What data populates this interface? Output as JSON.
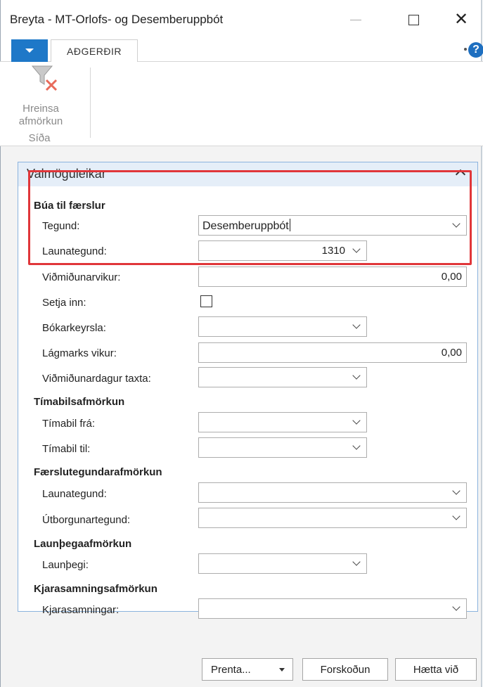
{
  "window": {
    "title": "Breyta - MT-Orlofs- og Desemberuppbót",
    "close_glyph": "✕"
  },
  "ribbon": {
    "tab_label": "AÐGERÐIR",
    "help_label": "?",
    "clear_filter_line1": "Hreinsa",
    "clear_filter_line2": "afmörkun",
    "group_label": "Síða"
  },
  "panel": {
    "title": "Valmöguleikar"
  },
  "sections": {
    "create_entries": "Búa til færslur",
    "period_filter": "Tímabilsafmörkun",
    "entry_type_filter": "Færslutegundarafmörkun",
    "employee_filter": "Launþegaafmörkun",
    "agreement_filter": "Kjarasamningsafmörkun"
  },
  "fields": {
    "tegund": {
      "label": "Tegund:",
      "value": "Desemberuppbót"
    },
    "launategund": {
      "label": "Launategund:",
      "value": "1310"
    },
    "vidmidunarvikur": {
      "label": "Viðmiðunarvikur:",
      "value": "0,00"
    },
    "setja_inn": {
      "label": "Setja inn:",
      "checked": false
    },
    "bokarkeyrsla": {
      "label": "Bókarkeyrsla:",
      "value": ""
    },
    "lagmarks_vikur": {
      "label": "Lágmarks vikur:",
      "value": "0,00"
    },
    "vidmidunardagur": {
      "label": "Viðmiðunardagur taxta:",
      "value": ""
    },
    "timabil_fra": {
      "label": "Tímabil frá:",
      "value": ""
    },
    "timabil_til": {
      "label": "Tímabil til:",
      "value": ""
    },
    "launategund_filter": {
      "label": "Launategund:",
      "value": ""
    },
    "utborgunartegund": {
      "label": "Útborgunartegund:",
      "value": ""
    },
    "launthegi": {
      "label": "Launþegi:",
      "value": ""
    },
    "kjarasamningar": {
      "label": "Kjarasamningar:",
      "value": ""
    }
  },
  "buttons": {
    "print": "Prenta...",
    "preview": "Forskoðun",
    "cancel": "Hætta við"
  },
  "colors": {
    "accent_blue": "#1e78c8",
    "highlight_red": "#e0363a",
    "panel_border": "#8bb3de",
    "panel_header_bg": "#e5eef8"
  }
}
